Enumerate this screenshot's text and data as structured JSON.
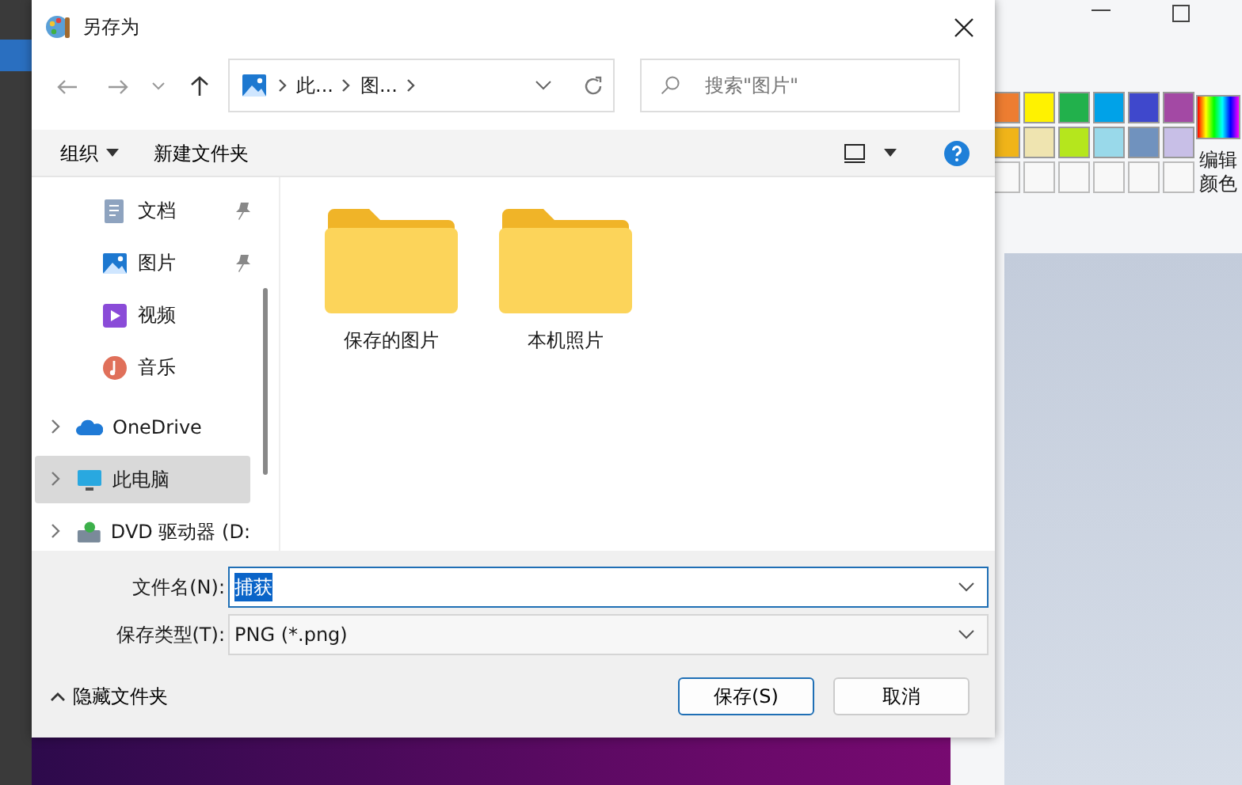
{
  "background_app": {
    "palette": [
      {
        "color": "#ed7d31"
      },
      {
        "color": "#fff200"
      },
      {
        "color": "#22b14c"
      },
      {
        "color": "#00a2e8"
      },
      {
        "color": "#3f48cc"
      },
      {
        "color": "#a349a4"
      },
      {
        "color": "#f0b419"
      },
      {
        "color": "#efe4b0"
      },
      {
        "color": "#b5e61d"
      },
      {
        "color": "#99d9ea"
      },
      {
        "color": "#7092be"
      },
      {
        "color": "#c8bfe7"
      }
    ],
    "edit_colors": "编辑颜色"
  },
  "dialog": {
    "title": "另存为",
    "address": {
      "segments": [
        "此...",
        "图..."
      ]
    },
    "search": {
      "placeholder": "搜索\"图片\""
    },
    "toolbar": {
      "organize": "组织",
      "new_folder": "新建文件夹"
    },
    "sidebar": {
      "items": [
        {
          "label": "文档",
          "kind": "documents",
          "pinned": true,
          "expandable": false,
          "selected": false
        },
        {
          "label": "图片",
          "kind": "pictures",
          "pinned": true,
          "expandable": false,
          "selected": false
        },
        {
          "label": "视频",
          "kind": "videos",
          "pinned": false,
          "expandable": false,
          "selected": false
        },
        {
          "label": "音乐",
          "kind": "music",
          "pinned": false,
          "expandable": false,
          "selected": false
        },
        {
          "label": "OneDrive",
          "kind": "cloud",
          "pinned": false,
          "expandable": true,
          "selected": false
        },
        {
          "label": "此电脑",
          "kind": "computer",
          "pinned": false,
          "expandable": true,
          "selected": true
        },
        {
          "label": "DVD 驱动器 (D:",
          "kind": "drive",
          "pinned": false,
          "expandable": true,
          "selected": false
        }
      ]
    },
    "folders": [
      {
        "name": "保存的图片"
      },
      {
        "name": "本机照片"
      }
    ],
    "file_name": {
      "label": "文件名(N):",
      "value": "捕获",
      "text_selected": true
    },
    "file_type": {
      "label": "保存类型(T):",
      "value": "PNG (*.png)"
    },
    "hide_folders": "隐藏文件夹",
    "buttons": [
      {
        "label": "保存(S)",
        "kind": "primary"
      },
      {
        "label": "取消",
        "kind": "secondary"
      }
    ]
  }
}
